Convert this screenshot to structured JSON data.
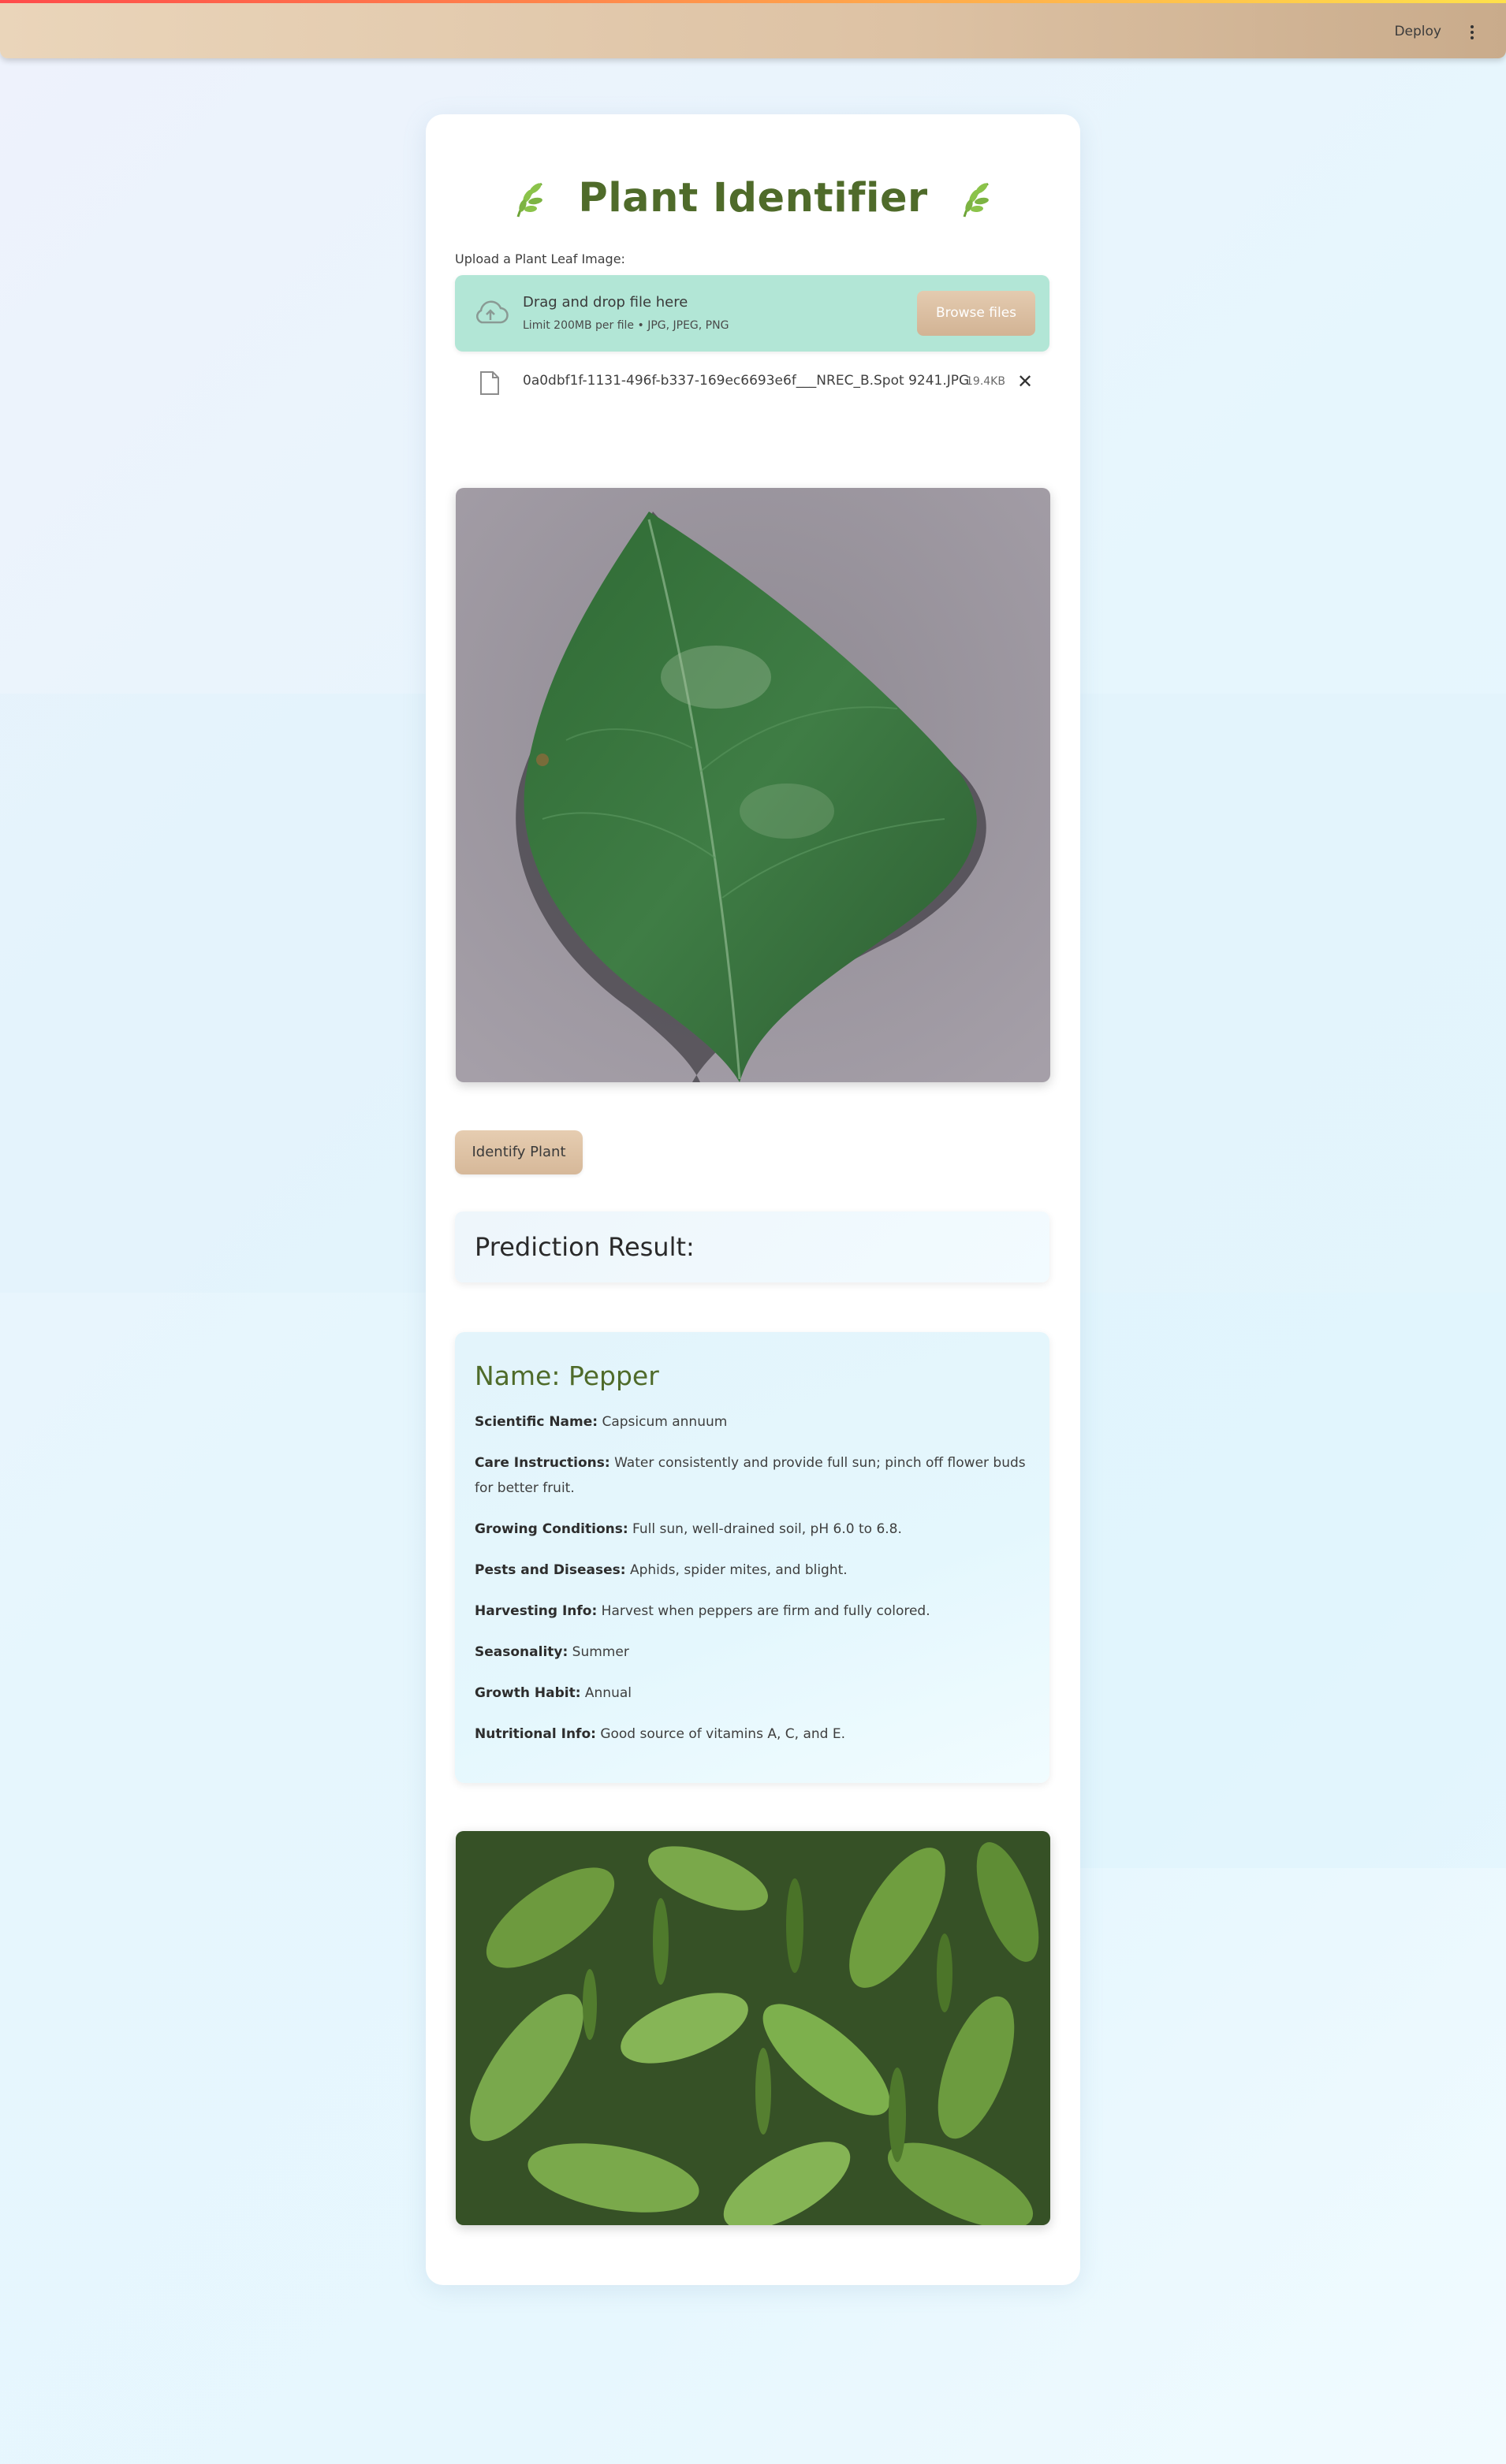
{
  "header": {
    "deploy_label": "Deploy",
    "menu_icon": "kebab-menu-icon"
  },
  "app": {
    "title": "Plant Identifier",
    "title_icon": "herb-icon"
  },
  "uploader": {
    "label": "Upload a Plant Leaf Image:",
    "drop_title": "Drag and drop file here",
    "drop_limit": "Limit 200MB per file • JPG, JPEG, PNG",
    "browse_label": "Browse files",
    "file_name": "0a0dbf1f-1131-496f-b337-169ec6693e6f___NREC_B.Spot 9241.JPG",
    "file_size": "19.4KB",
    "remove_symbol": "✕"
  },
  "actions": {
    "identify_label": "Identify Plant"
  },
  "result": {
    "heading": "Prediction Result:",
    "name_line": "Name: Pepper",
    "details": [
      {
        "key": "Scientific Name:",
        "value": " Capsicum annuum"
      },
      {
        "key": "Care Instructions:",
        "value": " Water consistently and provide full sun; pinch off flower buds for better fruit."
      },
      {
        "key": "Growing Conditions:",
        "value": " Full sun, well-drained soil, pH 6.0 to 6.8."
      },
      {
        "key": "Pests and Diseases:",
        "value": " Aphids, spider mites, and blight."
      },
      {
        "key": "Harvesting Info:",
        "value": " Harvest when peppers are firm and fully colored."
      },
      {
        "key": "Seasonality:",
        "value": " Summer"
      },
      {
        "key": "Growth Habit:",
        "value": " Annual"
      },
      {
        "key": "Nutritional Info:",
        "value": " Good source of vitamins A, C, and E."
      }
    ]
  },
  "colors": {
    "accent_green": "#4f6b2a",
    "dropzone": "#b2e6d6",
    "button_tan": "#d6b899"
  }
}
